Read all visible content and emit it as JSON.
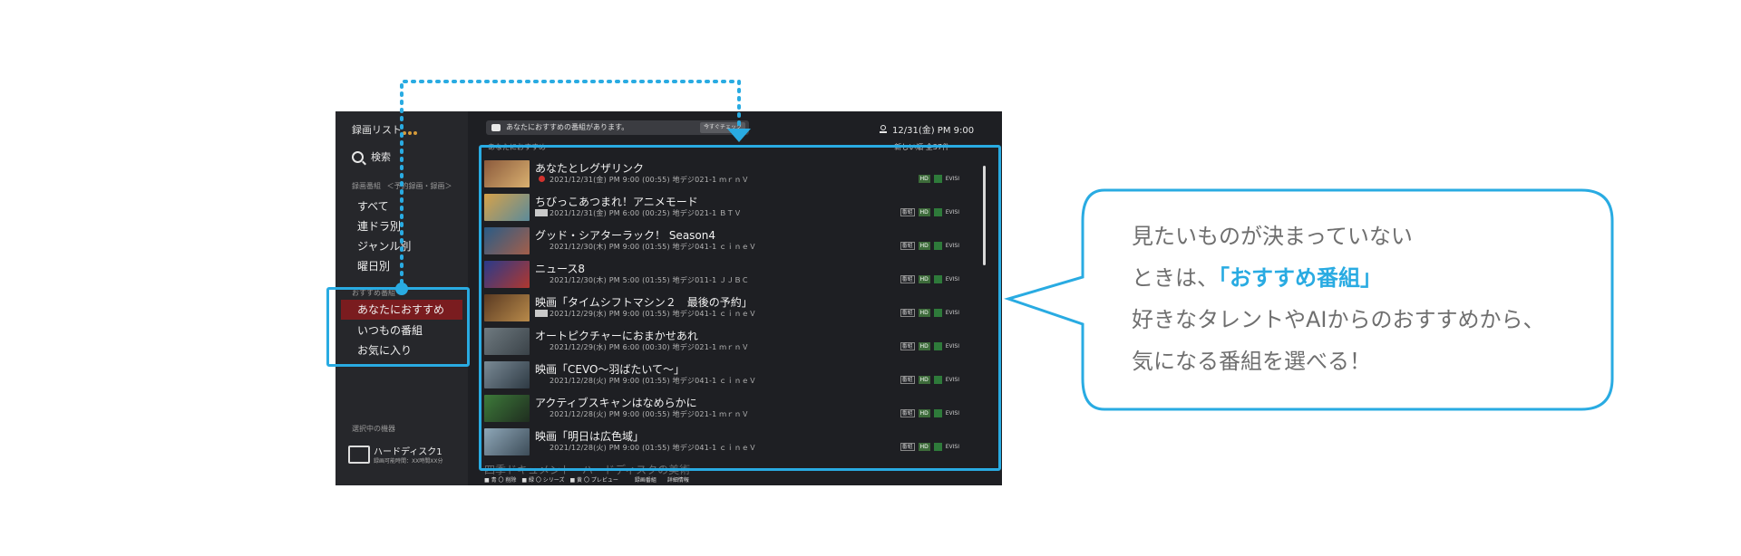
{
  "sidebar": {
    "title": "録画リスト",
    "search": "検索",
    "section_recorded": "録画番組",
    "section_recorded_filter": "＜予約録画・録画＞",
    "items": [
      "すべて",
      "連ドラ別",
      "ジャンル別",
      "曜日別"
    ],
    "section_recommend": "おすすめ番組",
    "recommend_items": [
      "あなたにおすすめ",
      "いつもの番組",
      "お気に入り"
    ],
    "selected_index": 0,
    "device_section": "選択中の機器",
    "device_name": "ハードディスク1",
    "device_sub": "録画可能時間：XX時間XX分"
  },
  "topbar": {
    "message": "あなたにおすすめの番組があります。",
    "message_button": "今すぐチェック",
    "clock": "12/31(金) PM 9:00"
  },
  "list": {
    "header": "あなたにおすすめ",
    "sort": "新しい順 全37件",
    "rows": [
      {
        "title": "あなたとレグザリンク",
        "meta": "2021/12/31(金) PM 9:00 (00:55) 地デジ021-1 ｍｒｎＶ",
        "marker": "dot",
        "thumb_a": "#8b5a3c",
        "thumb_b": "#d9b070"
      },
      {
        "title": "ちびっこあつまれ！アニメモード",
        "meta": "2021/12/31(金) PM 6:00 (00:25) 地デジ021-1 ＢＴＶ",
        "marker": "new",
        "thumb_a": "#d6a24a",
        "thumb_b": "#5c8b9a"
      },
      {
        "title": "グッド・シアターラック！ Season4",
        "meta": "2021/12/30(木) PM 9:00 (01:55) 地デジ041-1 ｃｉｎｅＶ",
        "marker": "",
        "thumb_a": "#2a5c86",
        "thumb_b": "#a35e4a"
      },
      {
        "title": "ニュース8",
        "meta": "2021/12/30(木) PM 5:00 (01:55) 地デジ011-1 ＪＪＢＣ",
        "marker": "",
        "thumb_a": "#2a3a8a",
        "thumb_b": "#b0382f"
      },
      {
        "title": "映画「タイムシフトマシン２　最後の予約」",
        "meta": "2021/12/29(水) PM 9:00 (01:55) 地デジ041-1 ｃｉｎｅＶ",
        "marker": "new",
        "thumb_a": "#5a3a22",
        "thumb_b": "#b88a4a"
      },
      {
        "title": "オートピクチャーにおまかせあれ",
        "meta": "2021/12/29(水) PM 6:00 (00:30) 地デジ021-1 ｍｒｎＶ",
        "marker": "",
        "thumb_a": "#6f7a80",
        "thumb_b": "#3a4248"
      },
      {
        "title": "映画「CEVO〜羽ばたいて〜」",
        "meta": "2021/12/28(火) PM 9:00 (01:55) 地デジ041-1 ｃｉｎｅＶ",
        "marker": "",
        "thumb_a": "#7a8a95",
        "thumb_b": "#2e3a44"
      },
      {
        "title": "アクティブスキャンはなめらかに",
        "meta": "2021/12/28(火) PM 9:00 (00:55) 地デジ021-1 ｍｒｎＶ",
        "marker": "",
        "thumb_a": "#3d7a3a",
        "thumb_b": "#1f2d1f"
      },
      {
        "title": "映画「明日は広色域」",
        "meta": "2021/12/28(火) PM 9:00 (01:55) 地デジ041-1 ｃｉｎｅＶ",
        "marker": "",
        "thumb_a": "#8ea7b8",
        "thumb_b": "#3d4c58"
      }
    ],
    "tag_hd": "HD",
    "tag_ch": "番組",
    "tag_label": "EVISI",
    "footer_row": "四季ドキュメント　ハードディスクの美術",
    "footer_bar": "■ 青 〇 削除　■ 緑 〇 シリーズ　■ 黄 〇 プレビュー　　　録画番組　　詳細情報"
  },
  "callout": {
    "line1": "見たいものが決まっていない",
    "line2_prefix": "ときは、",
    "line2_highlight": "「おすすめ番組」",
    "line3": "好きなタレントやAIからのおすすめから、",
    "line4": "気になる番組を選べる！"
  },
  "colors": {
    "accent": "#29abe2",
    "selection": "#7a1c1f",
    "tv_bg": "#1e1f23"
  }
}
